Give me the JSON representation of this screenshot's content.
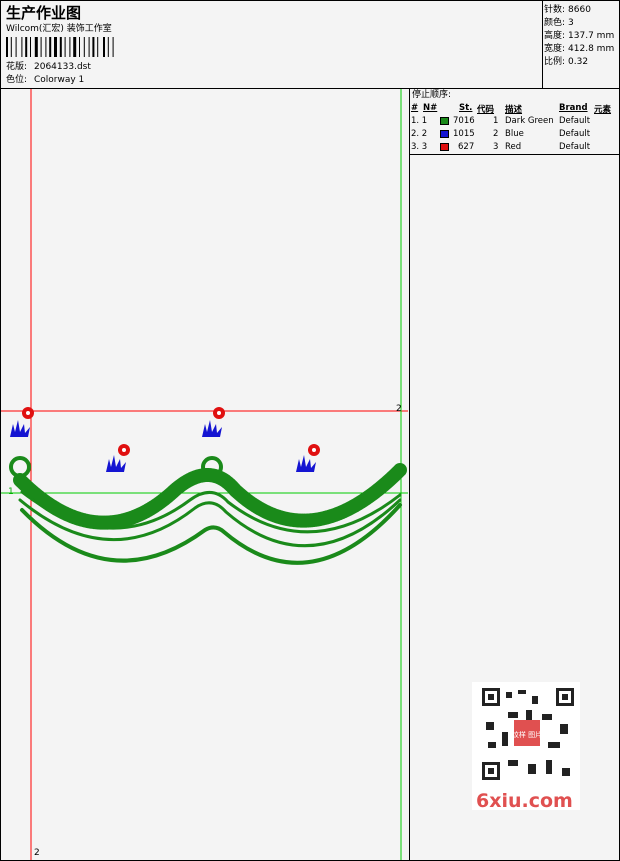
{
  "header": {
    "title": "生产作业图",
    "studio": "Wilcom(汇宏) 装饰工作室",
    "design_label": "花版:",
    "design_value": "2064133.dst",
    "colorway_label": "色位:",
    "colorway_value": "Colorway 1"
  },
  "stats": [
    {
      "label": "针数:",
      "value": "8660"
    },
    {
      "label": "颜色:",
      "value": "3"
    },
    {
      "label": "高度:",
      "value": "137.7 mm"
    },
    {
      "label": "宽度:",
      "value": "412.8 mm"
    },
    {
      "label": "比例:",
      "value": "0.32"
    }
  ],
  "stop_sequence": {
    "title": "停止顺序:",
    "columns": [
      "#",
      "N#",
      "St.",
      "代码",
      "描述",
      "Brand",
      "元素"
    ],
    "rows": [
      {
        "num": "1. 1",
        "color": "#1a8a1a",
        "stitches": "7016",
        "code": "1",
        "description": "Dark Green",
        "brand": "Default"
      },
      {
        "num": "2. 2",
        "color": "#1414d2",
        "stitches": "1015",
        "code": "2",
        "description": "Blue",
        "brand": "Default"
      },
      {
        "num": "3. 3",
        "color": "#e01010",
        "stitches": "627",
        "code": "3",
        "description": "Red",
        "brand": "Default"
      }
    ]
  },
  "guides": {
    "label_1": "1",
    "label_2": "2"
  },
  "watermark": {
    "text": "6xiu.com",
    "seal": "纹样 图片"
  },
  "colors": {
    "green": "#1a8a1a",
    "blue": "#1414d2",
    "red": "#e01010",
    "guide_red": "#ff0000",
    "guide_green": "#00cc00"
  }
}
